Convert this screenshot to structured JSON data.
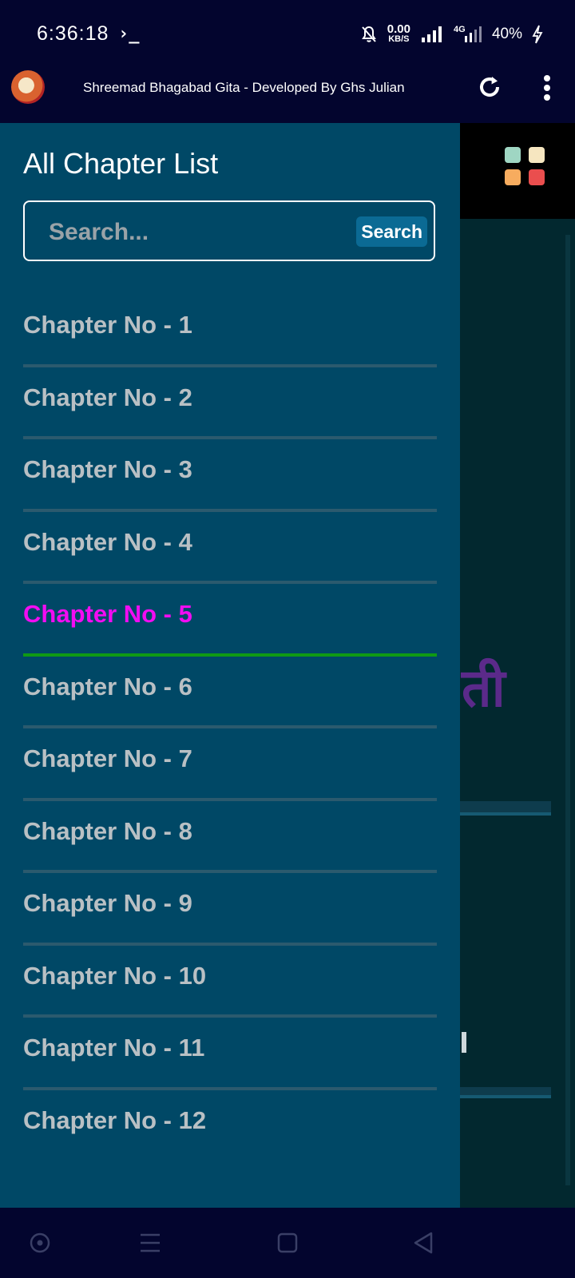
{
  "status_bar": {
    "time": "6:36:18",
    "terminal_glyph": "›_",
    "net_speed_value": "0.00",
    "net_speed_unit": "KB/S",
    "network_type": "4G",
    "battery": "40%"
  },
  "app_bar": {
    "title": "Shreemad Bhagabad Gita - Developed By Ghs Julian",
    "icons": [
      "app-logo",
      "refresh-icon",
      "more-vert-icon"
    ]
  },
  "background": {
    "hindi_text": "ती",
    "palette_colors": [
      "#9fd6c3",
      "#f6e6c0",
      "#f7ac5f",
      "#ea4e4e"
    ]
  },
  "drawer": {
    "title": "All Chapter List",
    "search": {
      "placeholder": "Search...",
      "button_label": "Search"
    },
    "active_index": 4,
    "chapters": [
      {
        "label": "Chapter No - 1"
      },
      {
        "label": "Chapter No - 2"
      },
      {
        "label": "Chapter No - 3"
      },
      {
        "label": "Chapter No - 4"
      },
      {
        "label": "Chapter No - 5"
      },
      {
        "label": "Chapter No - 6"
      },
      {
        "label": "Chapter No - 7"
      },
      {
        "label": "Chapter No - 8"
      },
      {
        "label": "Chapter No - 9"
      },
      {
        "label": "Chapter No - 10"
      },
      {
        "label": "Chapter No - 11"
      },
      {
        "label": "Chapter No - 12"
      }
    ]
  },
  "colors": {
    "drawer_bg": "#004866",
    "active_text": "#f20cf2",
    "active_underline": "#0f9a14",
    "item_text": "#b9c0c4"
  },
  "nav_bar": {
    "icons": [
      "assistant-icon",
      "menu-icon",
      "home-square-icon",
      "back-triangle-icon"
    ]
  }
}
